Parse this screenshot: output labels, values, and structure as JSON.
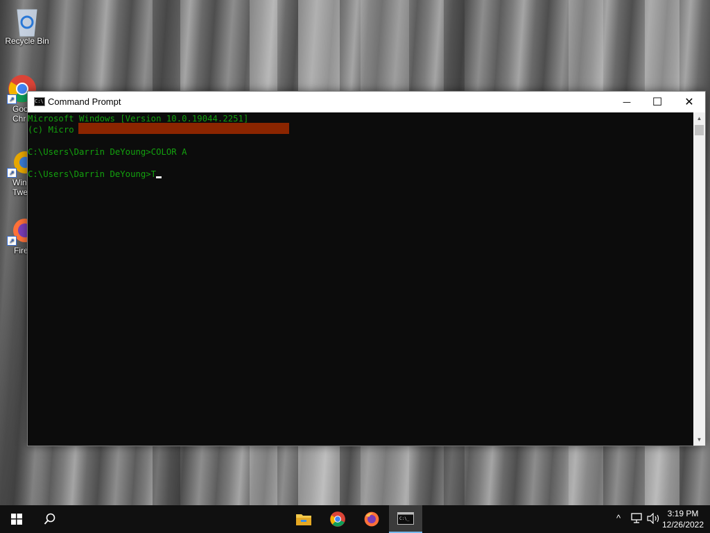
{
  "desktop": {
    "icons": [
      {
        "label": "Recycle Bin",
        "icon": "recycle-bin-icon"
      },
      {
        "label": "Goo\nChr",
        "icon": "chrome-icon"
      },
      {
        "label": "Win\nTwe",
        "icon": "app-icon"
      },
      {
        "label": "Fire",
        "icon": "firefox-icon"
      }
    ]
  },
  "window": {
    "title": "Command Prompt",
    "minimize": "—",
    "maximize": "☐",
    "close": "✕"
  },
  "console": {
    "lines": [
      "Microsoft Windows [Version 10.0.19044.2251]",
      "(c) Micro",
      "",
      "C:\\Users\\Darrin DeYoung>COLOR A",
      "",
      "C:\\Users\\Darrin DeYoung>T"
    ],
    "text_color": "#13a10e",
    "background": "#0c0c0c",
    "redaction_color": "#8b2500"
  },
  "taskbar": {
    "items": [
      {
        "name": "start",
        "icon": "windows-logo-icon"
      },
      {
        "name": "search",
        "icon": "search-icon"
      },
      {
        "name": "file-explorer",
        "icon": "folder-icon"
      },
      {
        "name": "chrome",
        "icon": "chrome-icon"
      },
      {
        "name": "firefox",
        "icon": "firefox-icon"
      },
      {
        "name": "command-prompt",
        "icon": "terminal-icon",
        "active": true
      }
    ],
    "tray": {
      "chevron": "^",
      "network_icon": "network-icon",
      "volume_icon": "volume-icon"
    },
    "time": "3:19 PM",
    "date": "12/26/2022"
  }
}
